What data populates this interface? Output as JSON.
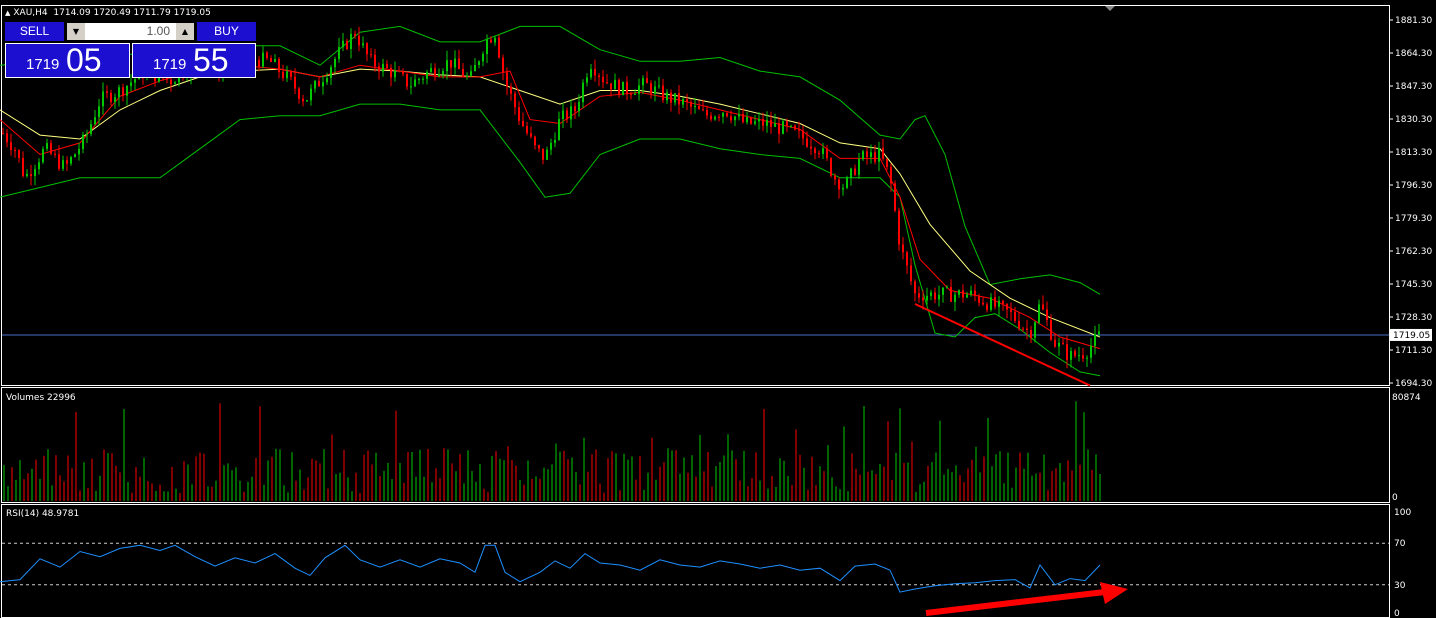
{
  "header": {
    "symbol": "XAU,H4",
    "ohlc": "1714.09 1720.49 1711.79 1719.05"
  },
  "trade_panel": {
    "sell_label": "SELL",
    "buy_label": "BUY",
    "lot": "1.00",
    "sell_price_main": "1719",
    "sell_price_big": "05",
    "buy_price_main": "1719",
    "buy_price_big": "55"
  },
  "price_axis": {
    "ticks": [
      "1881.30",
      "1864.30",
      "1847.30",
      "1830.30",
      "1813.30",
      "1796.30",
      "1779.30",
      "1762.30",
      "1745.30",
      "1728.30",
      "1711.30",
      "1694.30"
    ],
    "current_price": "1719.05",
    "range": [
      1694.3,
      1881.3
    ]
  },
  "volumes_panel": {
    "title": "Volumes 22996",
    "max_label": "80874",
    "min_label": "0",
    "range": [
      0,
      80874
    ]
  },
  "rsi_panel": {
    "title": "RSI(14) 48.9781",
    "ticks": [
      "100",
      "70",
      "30",
      "0"
    ],
    "levels": [
      70,
      30
    ],
    "range": [
      0,
      100
    ]
  },
  "colors": {
    "background": "#000000",
    "bull": "#00c800",
    "bear": "#ff0000",
    "bands": "#00c000",
    "ma_fast": "#ff0000",
    "ma_slow": "#ffff80",
    "rsi_line": "#1e90ff",
    "current_price_line": "#4a6ec8",
    "annotation": "#ff0000"
  },
  "chart_data": [
    {
      "type": "candlestick",
      "title": "XAU,H4",
      "ylim": [
        1694.3,
        1881.3
      ],
      "series": [
        {
          "name": "Bollinger Bands"
        },
        {
          "name": "Moving Averages"
        }
      ],
      "price_path": [
        [
          0,
          1825
        ],
        [
          15,
          1815
        ],
        [
          25,
          1800
        ],
        [
          45,
          1815
        ],
        [
          65,
          1805
        ],
        [
          85,
          1820
        ],
        [
          100,
          1840
        ],
        [
          120,
          1845
        ],
        [
          145,
          1855
        ],
        [
          170,
          1850
        ],
        [
          195,
          1860
        ],
        [
          215,
          1855
        ],
        [
          245,
          1862
        ],
        [
          270,
          1860
        ],
        [
          290,
          1850
        ],
        [
          305,
          1840
        ],
        [
          320,
          1850
        ],
        [
          340,
          1865
        ],
        [
          355,
          1875
        ],
        [
          370,
          1860
        ],
        [
          390,
          1855
        ],
        [
          410,
          1848
        ],
        [
          430,
          1855
        ],
        [
          450,
          1860
        ],
        [
          470,
          1850
        ],
        [
          485,
          1870
        ],
        [
          495,
          1875
        ],
        [
          505,
          1850
        ],
        [
          520,
          1830
        ],
        [
          535,
          1815
        ],
        [
          545,
          1810
        ],
        [
          560,
          1830
        ],
        [
          575,
          1835
        ],
        [
          590,
          1860
        ],
        [
          605,
          1850
        ],
        [
          625,
          1845
        ],
        [
          645,
          1848
        ],
        [
          665,
          1842
        ],
        [
          685,
          1838
        ],
        [
          705,
          1832
        ],
        [
          725,
          1835
        ],
        [
          745,
          1828
        ],
        [
          765,
          1828
        ],
        [
          785,
          1825
        ],
        [
          805,
          1820
        ],
        [
          820,
          1815
        ],
        [
          835,
          1800
        ],
        [
          845,
          1795
        ],
        [
          860,
          1810
        ],
        [
          880,
          1812
        ],
        [
          890,
          1800
        ],
        [
          900,
          1765
        ],
        [
          915,
          1740
        ],
        [
          930,
          1740
        ],
        [
          950,
          1740
        ],
        [
          970,
          1740
        ],
        [
          990,
          1735
        ],
        [
          1010,
          1730
        ],
        [
          1030,
          1720
        ],
        [
          1040,
          1735
        ],
        [
          1055,
          1715
        ],
        [
          1070,
          1708
        ],
        [
          1085,
          1710
        ],
        [
          1100,
          1719
        ]
      ],
      "band_upper": [
        [
          0,
          1858
        ],
        [
          40,
          1860
        ],
        [
          80,
          1855
        ],
        [
          120,
          1865
        ],
        [
          160,
          1860
        ],
        [
          200,
          1860
        ],
        [
          240,
          1868
        ],
        [
          280,
          1868
        ],
        [
          320,
          1858
        ],
        [
          360,
          1875
        ],
        [
          400,
          1878
        ],
        [
          440,
          1870
        ],
        [
          480,
          1870
        ],
        [
          520,
          1878
        ],
        [
          560,
          1878
        ],
        [
          600,
          1866
        ],
        [
          640,
          1860
        ],
        [
          680,
          1860
        ],
        [
          720,
          1862
        ],
        [
          760,
          1855
        ],
        [
          800,
          1852
        ],
        [
          840,
          1840
        ],
        [
          880,
          1822
        ],
        [
          900,
          1820
        ],
        [
          915,
          1830
        ],
        [
          925,
          1832
        ],
        [
          945,
          1812
        ],
        [
          965,
          1775
        ],
        [
          990,
          1745
        ],
        [
          1020,
          1748
        ],
        [
          1050,
          1750
        ],
        [
          1080,
          1746
        ],
        [
          1100,
          1740
        ]
      ],
      "band_lower": [
        [
          0,
          1790
        ],
        [
          40,
          1795
        ],
        [
          80,
          1800
        ],
        [
          120,
          1800
        ],
        [
          160,
          1800
        ],
        [
          200,
          1815
        ],
        [
          240,
          1830
        ],
        [
          280,
          1832
        ],
        [
          320,
          1832
        ],
        [
          360,
          1838
        ],
        [
          400,
          1838
        ],
        [
          440,
          1835
        ],
        [
          480,
          1835
        ],
        [
          520,
          1808
        ],
        [
          545,
          1790
        ],
        [
          570,
          1792
        ],
        [
          600,
          1812
        ],
        [
          640,
          1820
        ],
        [
          680,
          1820
        ],
        [
          720,
          1815
        ],
        [
          760,
          1812
        ],
        [
          800,
          1810
        ],
        [
          840,
          1800
        ],
        [
          880,
          1800
        ],
        [
          900,
          1790
        ],
        [
          915,
          1755
        ],
        [
          935,
          1720
        ],
        [
          955,
          1718
        ],
        [
          975,
          1728
        ],
        [
          995,
          1730
        ],
        [
          1020,
          1722
        ],
        [
          1050,
          1710
        ],
        [
          1080,
          1700
        ],
        [
          1100,
          1698
        ]
      ],
      "ma_fast": [
        [
          0,
          1830
        ],
        [
          40,
          1812
        ],
        [
          80,
          1818
        ],
        [
          120,
          1842
        ],
        [
          160,
          1850
        ],
        [
          200,
          1856
        ],
        [
          240,
          1858
        ],
        [
          280,
          1856
        ],
        [
          320,
          1852
        ],
        [
          360,
          1858
        ],
        [
          400,
          1855
        ],
        [
          440,
          1852
        ],
        [
          480,
          1852
        ],
        [
          510,
          1855
        ],
        [
          530,
          1830
        ],
        [
          560,
          1828
        ],
        [
          600,
          1842
        ],
        [
          640,
          1844
        ],
        [
          680,
          1840
        ],
        [
          720,
          1835
        ],
        [
          760,
          1830
        ],
        [
          800,
          1825
        ],
        [
          840,
          1810
        ],
        [
          880,
          1810
        ],
        [
          900,
          1790
        ],
        [
          920,
          1758
        ],
        [
          950,
          1742
        ],
        [
          990,
          1738
        ],
        [
          1030,
          1728
        ],
        [
          1060,
          1718
        ],
        [
          1100,
          1712
        ]
      ],
      "ma_slow": [
        [
          0,
          1835
        ],
        [
          40,
          1822
        ],
        [
          80,
          1820
        ],
        [
          120,
          1835
        ],
        [
          160,
          1845
        ],
        [
          200,
          1852
        ],
        [
          240,
          1855
        ],
        [
          280,
          1856
        ],
        [
          320,
          1852
        ],
        [
          360,
          1856
        ],
        [
          400,
          1855
        ],
        [
          440,
          1853
        ],
        [
          480,
          1852
        ],
        [
          520,
          1845
        ],
        [
          560,
          1838
        ],
        [
          600,
          1845
        ],
        [
          640,
          1845
        ],
        [
          680,
          1842
        ],
        [
          720,
          1838
        ],
        [
          760,
          1833
        ],
        [
          800,
          1828
        ],
        [
          840,
          1818
        ],
        [
          880,
          1815
        ],
        [
          900,
          1802
        ],
        [
          930,
          1776
        ],
        [
          970,
          1752
        ],
        [
          1010,
          1738
        ],
        [
          1050,
          1728
        ],
        [
          1100,
          1718
        ]
      ],
      "trendline": [
        [
          915,
          1735
        ],
        [
          1090,
          1693
        ]
      ]
    },
    {
      "type": "bar",
      "title": "Volumes 22996",
      "ylim": [
        0,
        80874
      ],
      "note_values": "bars generated to span full width"
    },
    {
      "type": "line",
      "title": "RSI(14) 48.9781",
      "ylim": [
        0,
        100
      ],
      "levels": [
        70,
        30
      ],
      "series": [
        {
          "name": "RSI(14)",
          "points": [
            [
              0,
              33
            ],
            [
              20,
              35
            ],
            [
              40,
              55
            ],
            [
              60,
              47
            ],
            [
              80,
              62
            ],
            [
              100,
              57
            ],
            [
              120,
              65
            ],
            [
              140,
              68
            ],
            [
              160,
              63
            ],
            [
              175,
              68
            ],
            [
              195,
              57
            ],
            [
              215,
              48
            ],
            [
              235,
              56
            ],
            [
              255,
              51
            ],
            [
              275,
              60
            ],
            [
              295,
              46
            ],
            [
              310,
              39
            ],
            [
              325,
              56
            ],
            [
              345,
              68
            ],
            [
              360,
              54
            ],
            [
              380,
              47
            ],
            [
              400,
              54
            ],
            [
              420,
              47
            ],
            [
              440,
              55
            ],
            [
              460,
              51
            ],
            [
              475,
              42
            ],
            [
              485,
              68
            ],
            [
              495,
              68
            ],
            [
              505,
              42
            ],
            [
              520,
              33
            ],
            [
              540,
              42
            ],
            [
              555,
              53
            ],
            [
              570,
              46
            ],
            [
              585,
              60
            ],
            [
              600,
              51
            ],
            [
              620,
              49
            ],
            [
              640,
              44
            ],
            [
              660,
              54
            ],
            [
              680,
              49
            ],
            [
              700,
              47
            ],
            [
              720,
              53
            ],
            [
              740,
              50
            ],
            [
              760,
              46
            ],
            [
              780,
              49
            ],
            [
              800,
              44
            ],
            [
              820,
              46
            ],
            [
              840,
              34
            ],
            [
              855,
              48
            ],
            [
              875,
              50
            ],
            [
              890,
              44
            ],
            [
              900,
              23
            ],
            [
              915,
              26
            ],
            [
              935,
              29
            ],
            [
              955,
              31
            ],
            [
              975,
              32
            ],
            [
              995,
              34
            ],
            [
              1015,
              35
            ],
            [
              1030,
              27
            ],
            [
              1040,
              49
            ],
            [
              1055,
              30
            ],
            [
              1070,
              36
            ],
            [
              1085,
              34
            ],
            [
              1100,
              49
            ]
          ]
        }
      ],
      "annotation_arrow": {
        "color": "#ff0000"
      }
    }
  ]
}
